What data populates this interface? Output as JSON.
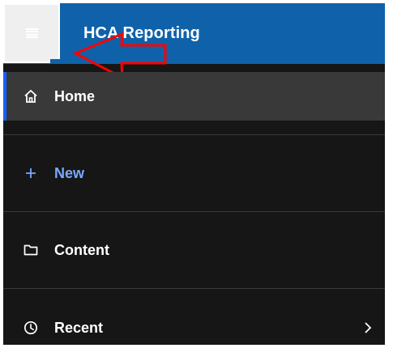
{
  "header": {
    "title": "HCA Reporting"
  },
  "nav": {
    "items": [
      {
        "label": "Home",
        "icon": "home-icon",
        "active": true
      },
      {
        "label": "New",
        "icon": "plus-icon",
        "active": false
      },
      {
        "label": "Content",
        "icon": "folder-icon",
        "active": false
      },
      {
        "label": "Recent",
        "icon": "clock-icon",
        "active": false,
        "chevron": "chevron-right-icon"
      }
    ]
  },
  "colors": {
    "header": "#0f62a9",
    "sidebar": "#161616",
    "active_item": "#393939",
    "active_indicator": "#0f62fe",
    "new_accent": "#78a9ff",
    "annotation": "#ff0000"
  }
}
